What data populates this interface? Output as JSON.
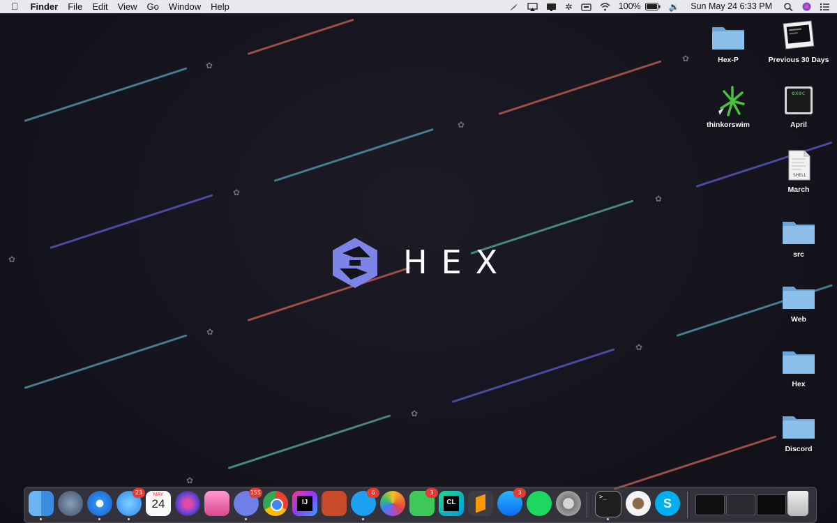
{
  "menubar": {
    "apple_icon": "apple-logo-icon",
    "app_name": "Finder",
    "menus": [
      "File",
      "Edit",
      "View",
      "Go",
      "Window",
      "Help"
    ],
    "battery_percent": "100%",
    "clock": "Sun May 24  6:33 PM",
    "status_icons": [
      "feather-icon",
      "airplay-icon",
      "screen-icon",
      "bluetooth-icon",
      "keyboard-icon",
      "wifi-icon",
      "battery-icon",
      "volume-icon",
      "search-icon",
      "siri-icon",
      "control-list-icon"
    ]
  },
  "wallpaper": {
    "brand_word": "HEX",
    "logo_icon": "hex-logo-icon",
    "colors": {
      "background": "#14131c",
      "logo": "#7c84e8"
    }
  },
  "desktop_icons": [
    {
      "label": "Hex-P",
      "icon": "folder-icon"
    },
    {
      "label": "Previous 30 Days",
      "icon": "smart-folder-icon"
    },
    {
      "label": "thinkorswim",
      "icon": "thinkorswim-icon"
    },
    {
      "label": "April",
      "icon": "exec-file-icon",
      "badge": "exec"
    },
    {
      "label": "March",
      "icon": "shell-script-icon",
      "badge": "SHELL"
    },
    {
      "label": "src",
      "icon": "folder-icon"
    },
    {
      "label": "Web",
      "icon": "folder-icon"
    },
    {
      "label": "Hex",
      "icon": "folder-icon"
    },
    {
      "label": "Discord",
      "icon": "folder-icon"
    }
  ],
  "dock": {
    "apps": [
      {
        "name": "Finder",
        "icon": "finder-icon",
        "running": true
      },
      {
        "name": "Launchpad",
        "icon": "launchpad-icon"
      },
      {
        "name": "Safari",
        "icon": "safari-icon",
        "running": true
      },
      {
        "name": "Messages",
        "icon": "messages-icon",
        "badge": "23",
        "running": true
      },
      {
        "name": "Calendar",
        "icon": "calendar-icon",
        "month": "MAY",
        "day": "24"
      },
      {
        "name": "Siri",
        "icon": "siri-icon"
      },
      {
        "name": "CleanMyMac",
        "icon": "cleanmymac-icon"
      },
      {
        "name": "Discord",
        "icon": "discord-icon",
        "badge": "155",
        "running": true
      },
      {
        "name": "Chrome",
        "icon": "chrome-icon"
      },
      {
        "name": "IntelliJ IDEA",
        "icon": "intellij-icon",
        "label": "IJ"
      },
      {
        "name": "Remote Desktop",
        "icon": "remote-desktop-icon"
      },
      {
        "name": "Twitter",
        "icon": "twitter-icon",
        "badge": "6",
        "running": true
      },
      {
        "name": "Photos",
        "icon": "photos-icon"
      },
      {
        "name": "FaceTime",
        "icon": "facetime-icon",
        "badge": "3"
      },
      {
        "name": "CLion",
        "icon": "clion-icon",
        "label": "CL"
      },
      {
        "name": "Sublime Text",
        "icon": "sublime-icon"
      },
      {
        "name": "App Store",
        "icon": "appstore-icon",
        "badge": "3"
      },
      {
        "name": "Spotify",
        "icon": "spotify-icon"
      },
      {
        "name": "System Preferences",
        "icon": "system-preferences-icon"
      },
      {
        "name": "Terminal",
        "icon": "terminal-icon",
        "label": ">_",
        "running": true
      },
      {
        "name": "Alfred",
        "icon": "alfred-icon"
      },
      {
        "name": "Skype",
        "icon": "skype-icon",
        "label": "S"
      }
    ],
    "minimized": [
      {
        "name": "Window 1",
        "icon": "window-thumbnail-icon"
      },
      {
        "name": "Window 2",
        "icon": "window-thumbnail-icon"
      },
      {
        "name": "Window 3",
        "icon": "window-thumbnail-icon"
      }
    ],
    "trash": {
      "name": "Trash",
      "icon": "trash-icon"
    }
  }
}
